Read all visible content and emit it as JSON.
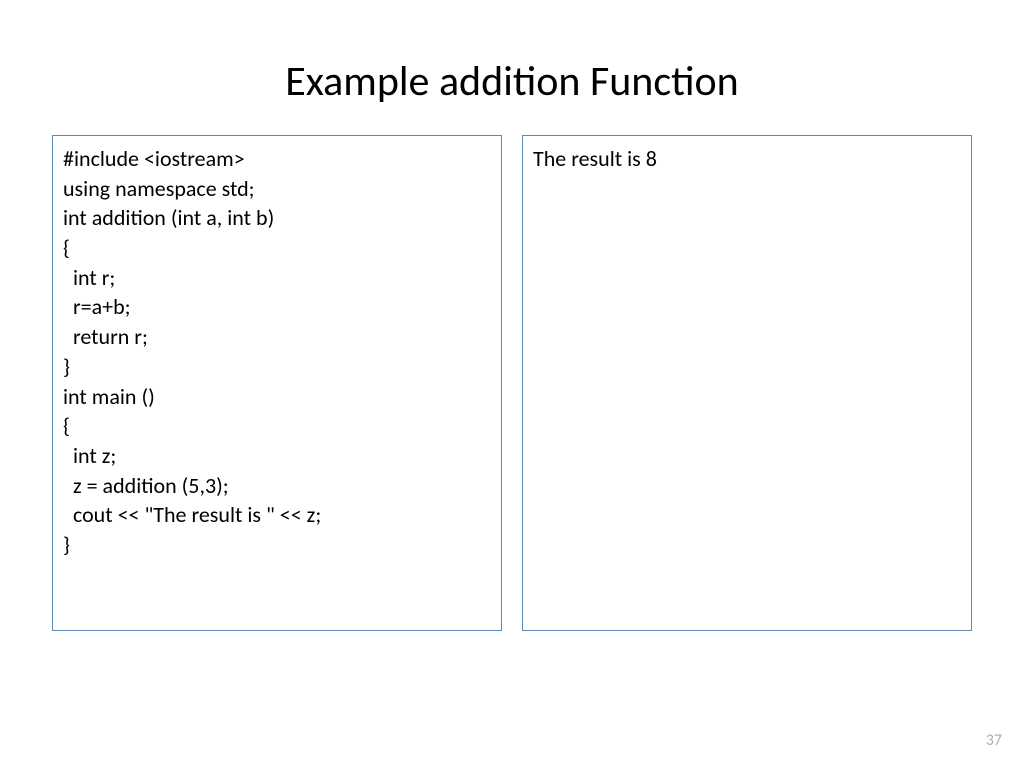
{
  "title": "Example addition Function",
  "code": {
    "lines": [
      "#include <iostream>",
      "using namespace std;",
      "",
      "int addition (int a, int b)",
      "{",
      "  int r;",
      "  r=a+b;",
      "  return r;",
      "}",
      "",
      "int main ()",
      "{",
      "  int z;",
      "  z = addition (5,3);",
      "  cout << \"The result is \" << z;",
      "}"
    ]
  },
  "output": "The result is 8",
  "pageNumber": "37"
}
